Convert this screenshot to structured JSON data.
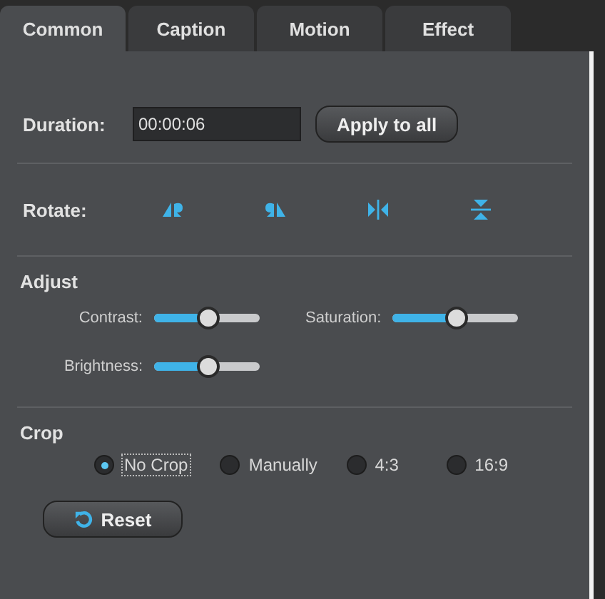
{
  "tabs": [
    {
      "label": "Common",
      "selected": true
    },
    {
      "label": "Caption",
      "selected": false
    },
    {
      "label": "Motion",
      "selected": false
    },
    {
      "label": "Effect",
      "selected": false
    }
  ],
  "duration": {
    "label": "Duration:",
    "value": "00:00:06",
    "button": "Apply to all"
  },
  "rotate": {
    "label": "Rotate:"
  },
  "adjust": {
    "title": "Adjust",
    "sliders": [
      {
        "name": "Contrast:",
        "level": 0.5
      },
      {
        "name": "Saturation:",
        "level": 0.5
      },
      {
        "name": "Brightness:",
        "level": 0.5
      }
    ]
  },
  "crop": {
    "title": "Crop",
    "options": [
      {
        "label": "No Crop",
        "selected": true
      },
      {
        "label": "Manually",
        "selected": false
      },
      {
        "label": "4:3",
        "selected": false
      },
      {
        "label": "16:9",
        "selected": false
      }
    ],
    "reset": "Reset"
  }
}
